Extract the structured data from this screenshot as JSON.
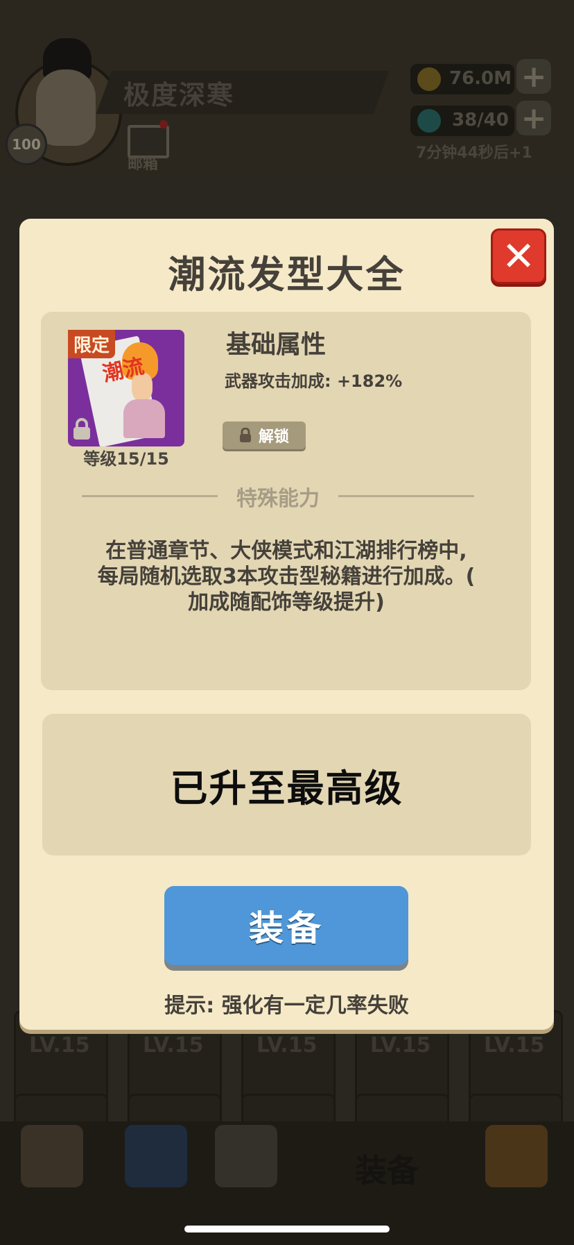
{
  "header": {
    "player_name": "极度深寒",
    "player_level": "100",
    "mail_label": "邮箱",
    "gold": "76.0M",
    "stamina": "38/40",
    "stamina_timer": "7分钟44秒后+1"
  },
  "background": {
    "lv_tags": [
      "LV.15",
      "LV.15",
      "LV.15",
      "LV.15",
      "LV.15"
    ],
    "nav_equip_label": "装备"
  },
  "dialog": {
    "title": "潮流发型大全",
    "item": {
      "limited_badge": "限定",
      "card_text": "潮流",
      "level_text": "等级15/15"
    },
    "base_attr_title": "基础属性",
    "base_attr_value": "武器攻击加成: +182%",
    "unlock_label": "解锁",
    "special_title": "特殊能力",
    "special_desc_lines": [
      "在普通章节、大侠模式和江湖排行榜中,",
      "每局随机选取3本攻击型秘籍进行加成。(",
      "加成随配饰等级提升)"
    ],
    "max_level_text": "已升至最高级",
    "equip_button": "装备",
    "hint": "提示: 强化有一定几率失败"
  },
  "colors": {
    "dialog_bg": "#f6e9c8",
    "panel_bg": "#e3d6b3",
    "close_red": "#e03a2c",
    "equip_blue": "#4f97d8",
    "limited_orange": "#c84a22",
    "card_purple": "#7b2f9c"
  },
  "icons": [
    "close-icon",
    "lock-icon",
    "mail-icon",
    "coin-icon",
    "gem-icon",
    "plus-icon"
  ]
}
